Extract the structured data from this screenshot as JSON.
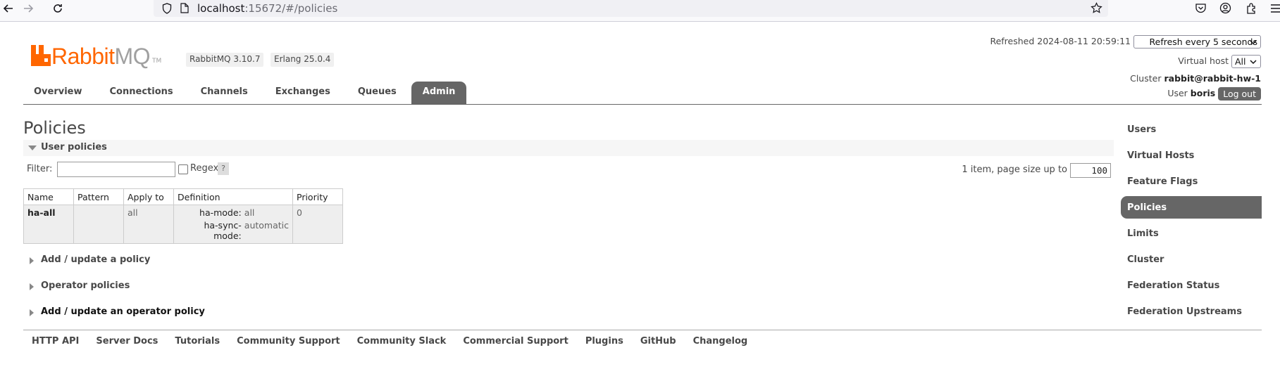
{
  "browser": {
    "url_host": "localhost",
    "url_rest": ":15672/#/policies"
  },
  "header": {
    "logo_rabbit": "Rabbit",
    "logo_mq": "MQ",
    "logo_tm": "TM",
    "rabbitmq_version": "RabbitMQ 3.10.7",
    "erlang_version": "Erlang 25.0.4",
    "refreshed_label": "Refreshed 2024-08-11 20:59:11",
    "refresh_select": "Refresh every 5 seconds",
    "vhost_label": "Virtual host",
    "vhost_select": "All",
    "cluster_label": "Cluster",
    "cluster_name": "rabbit@rabbit-hw-1",
    "user_label": "User",
    "user_name": "boris",
    "logout_label": "Log out"
  },
  "tabs": [
    {
      "label": "Overview"
    },
    {
      "label": "Connections"
    },
    {
      "label": "Channels"
    },
    {
      "label": "Exchanges"
    },
    {
      "label": "Queues"
    },
    {
      "label": "Admin",
      "active": true
    }
  ],
  "main": {
    "title": "Policies",
    "user_policies_label": "User policies",
    "filter_label": "Filter:",
    "regex_label": "Regex",
    "help_label": "?",
    "page_size_label": "1 item, page size up to",
    "page_size_value": "100",
    "table": {
      "headers": [
        "Name",
        "Pattern",
        "Apply to",
        "Definition",
        "Priority"
      ],
      "rows": [
        {
          "name": "ha-all",
          "pattern": "",
          "apply_to": "all",
          "definition": [
            {
              "key": "ha-mode:",
              "value": "all"
            },
            {
              "key": "ha-sync-mode:",
              "value": "automatic"
            }
          ],
          "priority": "0"
        }
      ]
    },
    "add_policy_label": "Add / update a policy",
    "operator_policies_label": "Operator policies",
    "add_operator_policy_label": "Add / update an operator policy"
  },
  "admin_nav": [
    {
      "label": "Users"
    },
    {
      "label": "Virtual Hosts"
    },
    {
      "label": "Feature Flags"
    },
    {
      "label": "Policies",
      "active": true
    },
    {
      "label": "Limits"
    },
    {
      "label": "Cluster"
    },
    {
      "label": "Federation Status"
    },
    {
      "label": "Federation Upstreams"
    }
  ],
  "footer": [
    {
      "label": "HTTP API"
    },
    {
      "label": "Server Docs"
    },
    {
      "label": "Tutorials"
    },
    {
      "label": "Community Support"
    },
    {
      "label": "Community Slack"
    },
    {
      "label": "Commercial Support"
    },
    {
      "label": "Plugins"
    },
    {
      "label": "GitHub"
    },
    {
      "label": "Changelog"
    }
  ],
  "colors": {
    "brand_orange": "#ff6600",
    "active_tab_bg": "#666666",
    "text": "#484848"
  }
}
